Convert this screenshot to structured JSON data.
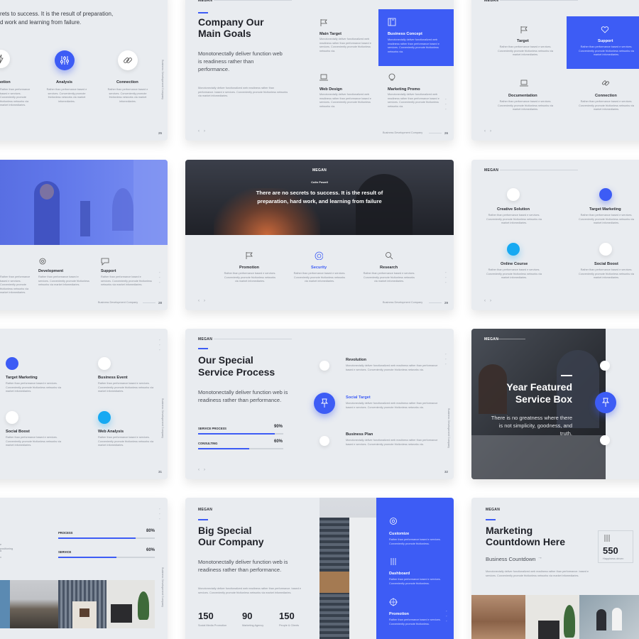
{
  "colors": {
    "accent": "#3d5cf5",
    "cyan": "#16a9f2",
    "bg": "#e9ecf0",
    "dark": "#1f2128"
  },
  "brand": "MEGAN",
  "footer_text": "Business Development Company",
  "lorem_short": "Rather than performance based e services. Conveniently promote frictionless networks via market infomediaries.",
  "lorem_long": "Monotonectally deliver functionalized web readiness rather than performance. based e services. Conveniently promote frictionless networks via market infomediaries.",
  "lorem_mid": "Monotonectally deliver functionalized web readiness rather than performance based e services. Conveniently promote frictionless networks via.",
  "s1": {
    "quote_a": "rets to success.  It is the result of preparation,",
    "quote_b": "d work and learning from failure.",
    "f1": "motion",
    "f2": "Analysis",
    "f3": "Connection",
    "num": "25"
  },
  "s2": {
    "title_a": "Company Our",
    "title_b": "Main Goals",
    "lead": "Monotonectally deliver function web is  readiness rather than performance.",
    "f1": "Main Target",
    "f2": "Business Concept",
    "f3": "Web Design",
    "f4": "Marketing Promo",
    "num": "26"
  },
  "s3": {
    "f1": "Target",
    "f2": "Support",
    "f3": "Documentation",
    "f4": "Connection"
  },
  "s4": {
    "f1": "Development",
    "f2": "Support",
    "num": "28"
  },
  "s5": {
    "brand": "MEGAN",
    "author": "Colin Powell",
    "quote": "There are no secrets to success. It is the result of preparation, hard work, and learning from failure",
    "f1": "Promotion",
    "f2": "Security",
    "f3": "Research",
    "num": "29"
  },
  "s6": {
    "f1": "Creative Solution",
    "f2": "Target Marketing",
    "f3": "Online Course",
    "f4": "Social Boost"
  },
  "s7": {
    "f1": "Target Marketing",
    "f2": "Business Event",
    "f3": "Social Boost",
    "f4": "Web Analysis",
    "num": "31"
  },
  "s8": {
    "title_a": "Our Special",
    "title_b": "Service Process",
    "lead": "Monotonectally deliver function web is readiness rather than performance.",
    "bar1": "SERVICE PROCESS",
    "bar1_pct": "90%",
    "bar1_val": 0.9,
    "bar2": "CONSULTING",
    "bar2_pct": "60%",
    "bar2_val": 0.6,
    "f1": "Revolution",
    "f2": "Social Target",
    "f3": "Business Plan",
    "num": "32"
  },
  "s9": {
    "title_a": "Year Featured",
    "title_b": "Service Box",
    "lead": "There is no greatness where there is not simplicity, goodness, and truth."
  },
  "s10": {
    "bar1": "PROCESS",
    "bar1_pct": "80%",
    "bar1_val": 0.8,
    "bar2": "SERVICE",
    "bar2_pct": "60%",
    "bar2_val": 0.6,
    "frag": "positioning"
  },
  "s11": {
    "title_a": "Big Special",
    "title_b": "Our Company",
    "lead": "Monotonectally deliver function web is readiness rather than performance.",
    "n1": "150",
    "l1": "Social Media Promotion",
    "n2": "90",
    "l2": "Marketing Agency",
    "n3": "150",
    "l3": "People & Clients",
    "b1": "Customize",
    "b2": "Dashboard",
    "b3": "Promotion",
    "btxt": "Rather than performance based e services. Conveniently promote frictionless."
  },
  "s12": {
    "title_a": "Marketing",
    "title_b": "Countdown Here",
    "sub": "Business Countdown",
    "num": "550",
    "numlbl": "Happiness driven"
  }
}
